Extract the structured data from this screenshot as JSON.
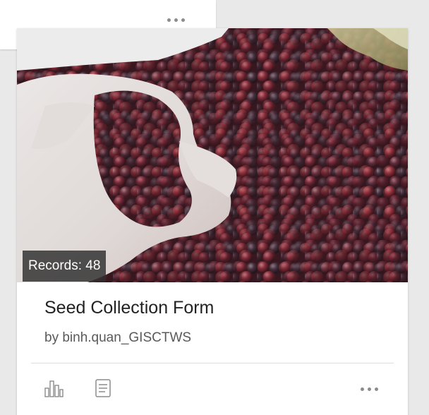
{
  "previous_card": {
    "more_icon": "ellipsis-icon"
  },
  "item_card": {
    "thumbnail_description_icon": "seed-photo",
    "records_label": "Records: 48",
    "title": "Seed Collection Form",
    "owner": "by binh.quan_GISCTWS",
    "actions": [
      {
        "icon": "bar-chart-icon"
      },
      {
        "icon": "document-icon"
      },
      {
        "icon": "ellipsis-icon"
      }
    ]
  },
  "colors": {
    "page_background": "#e9e9e9",
    "card_background": "#ffffff",
    "badge_background": "#2d2d2d",
    "icon_gray": "#8c8c8c"
  }
}
